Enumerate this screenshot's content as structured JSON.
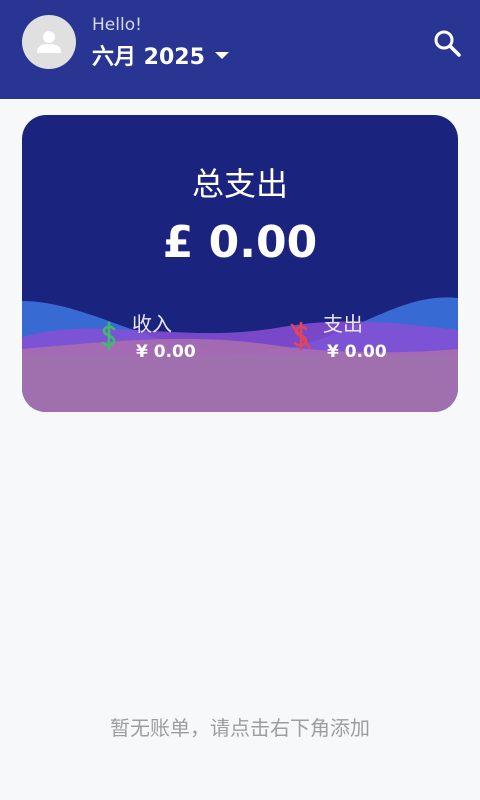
{
  "header": {
    "greeting": "Hello!",
    "month_label": "六月 2025",
    "avatar_icon": "person-icon",
    "search_icon": "search-icon",
    "dropdown_icon": "caret-down-icon"
  },
  "summary_card": {
    "total_label": "总支出",
    "total_value": "£ 0.00",
    "income": {
      "label": "收入",
      "value": "¥ 0.00",
      "icon": "dollar-icon",
      "icon_color": "#3fb96d"
    },
    "expense": {
      "label": "支出",
      "value": "¥ 0.00",
      "icon": "dollar-off-icon",
      "icon_color": "#e0455a"
    }
  },
  "empty_state": {
    "message": "暂无账单，请点击右下角添加"
  },
  "colors": {
    "app_bar": "#283593",
    "card_background": "#1a237e",
    "page_background": "#f7f8fa"
  }
}
